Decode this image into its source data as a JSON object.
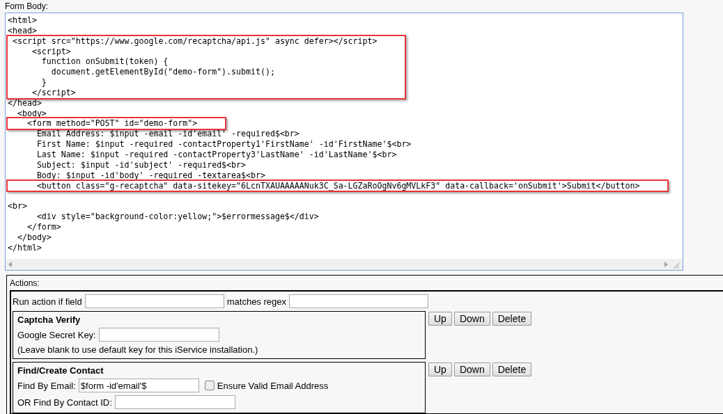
{
  "form_body": {
    "label": "Form Body:",
    "blocks": [
      {
        "highlighted": false,
        "lines": [
          "<html>",
          "<head>"
        ]
      },
      {
        "highlighted": true,
        "lines": [
          " <script src=\"https://www.google.com/recaptcha/api.js\" async defer></script>",
          "     <script>",
          "       function onSubmit(token) {",
          "         document.getElementById(\"demo-form\").submit();",
          "       }",
          "     </script>"
        ]
      },
      {
        "highlighted": false,
        "lines": [
          "</head>",
          "  <body>"
        ]
      },
      {
        "highlighted": true,
        "lines": [
          "    <form method=\"POST\" id=\"demo-form\">"
        ]
      },
      {
        "highlighted": false,
        "lines": [
          "      Email Address: $input -email -id'email' -required$<br>",
          "      First Name: $input -required -contactProperty1'FirstName' -id'FirstName'$<br>",
          "      Last Name: $input -required -contactProperty3'LastName' -id'LastName'$<br>",
          "      Subject: $input -id'subject' -required$<br>",
          "      Body: $input -id'body' -required -textarea$<br>"
        ]
      },
      {
        "highlighted": true,
        "lines": [
          "      <button class=\"g-recaptcha\" data-sitekey=\"6LcnTXAUAAAAANuk3C_Sa-LGZaRoOgNv6gMVLkF3\" data-callback='onSubmit'>Submit</button>"
        ]
      },
      {
        "highlighted": false,
        "blank_line_before": true,
        "lines": [
          "<br>",
          "      <div style=\"background-color:yellow;\">$errormessage$</div>",
          "    </form>",
          "  </body>",
          "</html>"
        ]
      }
    ]
  },
  "actions": {
    "label": "Actions:",
    "condition": {
      "field_label": "Run action if field",
      "regex_label": "matches regex"
    },
    "items": [
      {
        "title": "Captcha Verify",
        "buttons": [
          "Up",
          "Down",
          "Delete"
        ],
        "rows": [
          {
            "kind": "field",
            "label": "Google Secret Key:"
          },
          {
            "kind": "note",
            "text": "(Leave blank to use default key for this iService installation.)"
          }
        ]
      },
      {
        "title": "Find/Create Contact",
        "buttons": [
          "Up",
          "Down",
          "Delete"
        ],
        "rows": [
          {
            "kind": "field",
            "label": "Find By Email:",
            "value": "$form -id'email'$",
            "checkbox": {
              "label": "Ensure Valid Email Address",
              "checked": false
            }
          },
          {
            "kind": "field",
            "label": "OR Find By Contact ID:"
          }
        ]
      }
    ]
  }
}
